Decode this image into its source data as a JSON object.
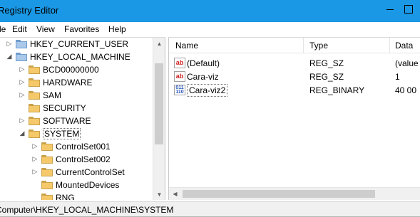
{
  "window": {
    "title": "Registry Editor"
  },
  "menu": [
    "File",
    "Edit",
    "View",
    "Favorites",
    "Help"
  ],
  "tree": [
    {
      "label": "HKEY_CURRENT_USER",
      "expander": "▷",
      "folder": "blue"
    },
    {
      "label": "HKEY_LOCAL_MACHINE",
      "expander": "◢",
      "folder": "blue"
    },
    {
      "label": "BCD00000000",
      "expander": "▷",
      "folder": "yellow"
    },
    {
      "label": "HARDWARE",
      "expander": "▷",
      "folder": "yellow"
    },
    {
      "label": "SAM",
      "expander": "▷",
      "folder": "yellow"
    },
    {
      "label": "SECURITY",
      "expander": "",
      "folder": "yellow"
    },
    {
      "label": "SOFTWARE",
      "expander": "▷",
      "folder": "yellow"
    },
    {
      "label": "SYSTEM",
      "expander": "◢",
      "folder": "yellow",
      "selected": true
    },
    {
      "label": "ControlSet001",
      "expander": "▷",
      "folder": "yellow"
    },
    {
      "label": "ControlSet002",
      "expander": "▷",
      "folder": "yellow"
    },
    {
      "label": "CurrentControlSet",
      "expander": "▷",
      "folder": "yellow"
    },
    {
      "label": "MountedDevices",
      "expander": "",
      "folder": "yellow"
    },
    {
      "label": "RNG",
      "expander": "",
      "folder": "yellow"
    }
  ],
  "list": {
    "columns": [
      "Name",
      "Type",
      "Data"
    ],
    "rows": [
      {
        "name": "(Default)",
        "type": "REG_SZ",
        "data": "(value",
        "icon": "ab",
        "icon_name": "string-value-icon"
      },
      {
        "name": "Cara-viz",
        "type": "REG_SZ",
        "data": "1",
        "icon": "ab",
        "icon_name": "string-value-icon"
      },
      {
        "name": "Cara-viz2",
        "type": "REG_BINARY",
        "data": "40 00",
        "icon": "011\n110",
        "icon_name": "binary-value-icon",
        "focused": true
      }
    ]
  },
  "status": {
    "path": "Computer\\HKEY_LOCAL_MACHINE\\SYSTEM"
  },
  "colors": {
    "titlebar": "#1a98e6",
    "folder_yellow": "#f5c96a",
    "folder_blue": "#a9c8ea"
  }
}
